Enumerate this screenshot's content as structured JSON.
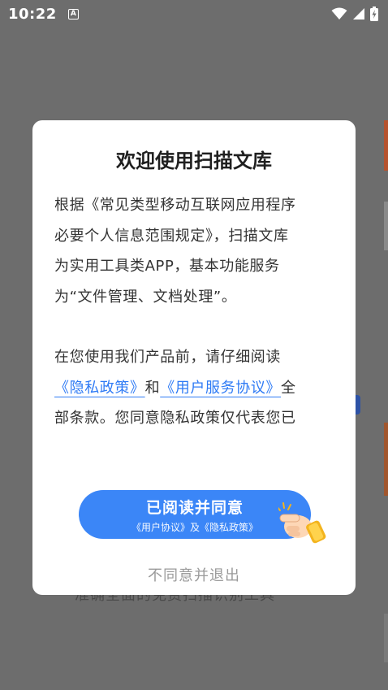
{
  "status_bar": {
    "time": "10:22",
    "notification_icon": "A",
    "icons": [
      "wifi-icon",
      "cell-signal-icon",
      "battery-charging-icon"
    ]
  },
  "background": {
    "partial_text": "准确全面的免费扫描识别工具"
  },
  "dialog": {
    "title": "欢迎使用扫描文库",
    "lines_p1": [
      "根据《常见类型移动互联网应用程序",
      "必要个人信息范围规定》，扫描文库",
      "为实用工具类APP，基本功能服务",
      "为“文件管理、文档处理”。"
    ],
    "p2_line1": "在您使用我们产品前，请仔细阅读",
    "privacy_link": "《隐私政策》",
    "and_text": "和",
    "agreement_link": "《用户服务协议》",
    "all_text": "全",
    "p2_line3": "部条款。您同意隐私政策仅代表您已",
    "agree_button": {
      "label": "已阅读并同意",
      "sublabel": "《用户协议》及《隐私政策》"
    },
    "decline_label": "不同意并退出"
  },
  "colors": {
    "accent": "#3b86f7",
    "link": "#2f7bf5",
    "overlay": "#6d6d6d"
  }
}
